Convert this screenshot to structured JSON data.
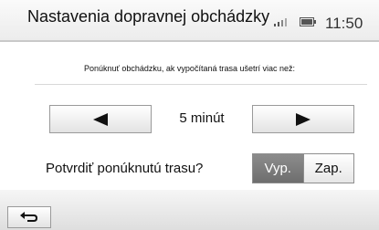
{
  "header": {
    "title": "Nastavenia dopravnej obchádzky",
    "clock": "11:50",
    "signal_icon": "signal-strength-icon",
    "battery_icon": "battery-icon"
  },
  "detour": {
    "prompt": "Ponúknuť obchádzku, ak vypočítaná trasa ušetrí viac než:",
    "duration": "5 minút",
    "prev_icon": "triangle-left-icon",
    "next_icon": "triangle-right-icon"
  },
  "confirm": {
    "label": "Potvrdiť ponúknutú trasu?",
    "off": "Vyp.",
    "on": "Zap.",
    "selected": "off"
  },
  "footer": {
    "back_icon": "return-arrow-icon"
  },
  "colors": {
    "selected_option_bg": "#7d7d7d",
    "button_border": "#9a9a9a"
  }
}
